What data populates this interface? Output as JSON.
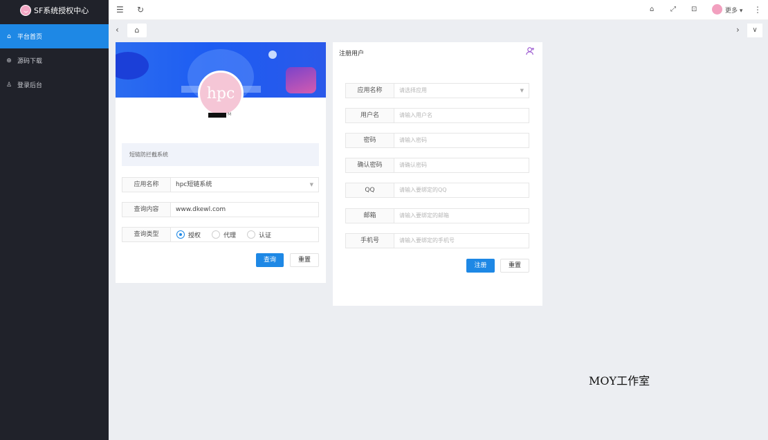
{
  "app": {
    "title": "SF系统授权中心"
  },
  "sidebar": {
    "items": [
      {
        "label": "平台首页",
        "icon": "home-icon",
        "active": true
      },
      {
        "label": "源码下载",
        "icon": "download-icon",
        "active": false
      },
      {
        "label": "登录后台",
        "icon": "user-icon",
        "active": false
      }
    ]
  },
  "header": {
    "more_label": "更多"
  },
  "query_card": {
    "avatar_text": "hpc",
    "description": "短链防拦截系统",
    "app_name": {
      "label": "应用名称",
      "value": "hpc短链系统"
    },
    "query_content": {
      "label": "查询内容",
      "value": "www.dkewl.com"
    },
    "query_type": {
      "label": "查询类型",
      "options": [
        "授权",
        "代理",
        "认证"
      ],
      "selected": "授权"
    },
    "query_button": "查询",
    "reset_button": "重置"
  },
  "register_card": {
    "title": "注册用户",
    "fields": [
      {
        "label": "应用名称",
        "placeholder": "请选择应用",
        "type": "select"
      },
      {
        "label": "用户名",
        "placeholder": "请输入用户名",
        "type": "input"
      },
      {
        "label": "密码",
        "placeholder": "请输入密码",
        "type": "input"
      },
      {
        "label": "确认密码",
        "placeholder": "请确认密码",
        "type": "input"
      },
      {
        "label": "QQ",
        "placeholder": "请输入要绑定的QQ",
        "type": "input"
      },
      {
        "label": "邮箱",
        "placeholder": "请输入要绑定的邮箱",
        "type": "input"
      },
      {
        "label": "手机号",
        "placeholder": "请输入要绑定的手机号",
        "type": "input"
      }
    ],
    "register_button": "注册",
    "reset_button": "重置"
  },
  "watermark": "MOY工作室",
  "colors": {
    "accent": "#1e88e5",
    "sidebar_bg": "#20222a"
  }
}
